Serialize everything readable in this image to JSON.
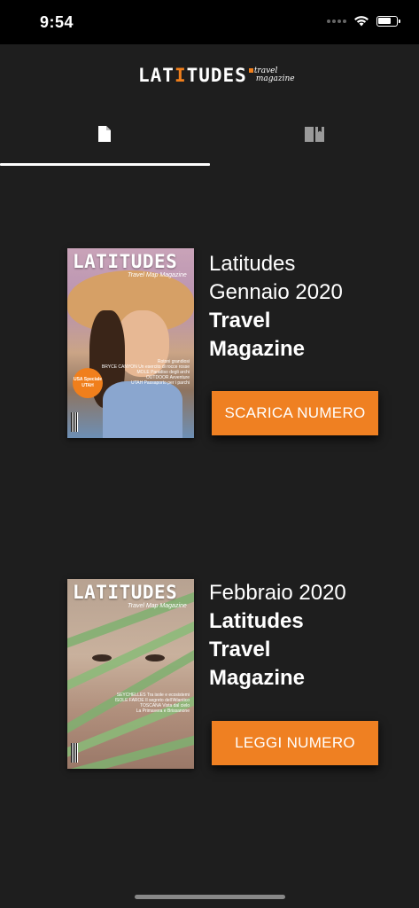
{
  "status": {
    "time": "9:54"
  },
  "header": {
    "logo_main_pre": "LAT",
    "logo_main_accent": "I",
    "logo_main_post": "TUDES",
    "logo_sub_top": "travel",
    "logo_sub_bottom": "magazine"
  },
  "tabs": [
    {
      "name": "issues",
      "icon": "document-icon",
      "active": true
    },
    {
      "name": "reader",
      "icon": "book-icon",
      "active": false
    }
  ],
  "issues": [
    {
      "cover": {
        "masthead": "LATITUDES",
        "subtitle": "Travel Map Magazine",
        "badge": "USA Speciale UTAH",
        "lines": [
          "Rotoni grandiosi",
          "BRYCE CANYON Un esercito di rocce rosse",
          "MOLE Paradiso degli archi",
          "OUTDOOR Avventure",
          "UTAH Passaporto per i parchi"
        ]
      },
      "title_lines": [
        "Latitudes",
        "Gennaio 2020"
      ],
      "title_bold_lines": [
        "Travel",
        "Magazine"
      ],
      "button_label": "SCARICA NUMERO"
    },
    {
      "cover": {
        "masthead": "LATITUDES",
        "subtitle": "Travel Map Magazine",
        "lines": [
          "SEYCHELLES Tra isole e ecosistemi",
          "ISOLE FAROE Il segreto dell'Atlantico",
          "TOSCANA Vista dal cielo",
          "La Primavera e Brissanone"
        ]
      },
      "title_lines": [
        "Febbraio 2020"
      ],
      "title_bold_lines": [
        "Latitudes",
        "Travel",
        "Magazine"
      ],
      "button_label": "LEGGI NUMERO"
    }
  ],
  "colors": {
    "accent": "#ef8022",
    "background": "#1e1e1e"
  }
}
